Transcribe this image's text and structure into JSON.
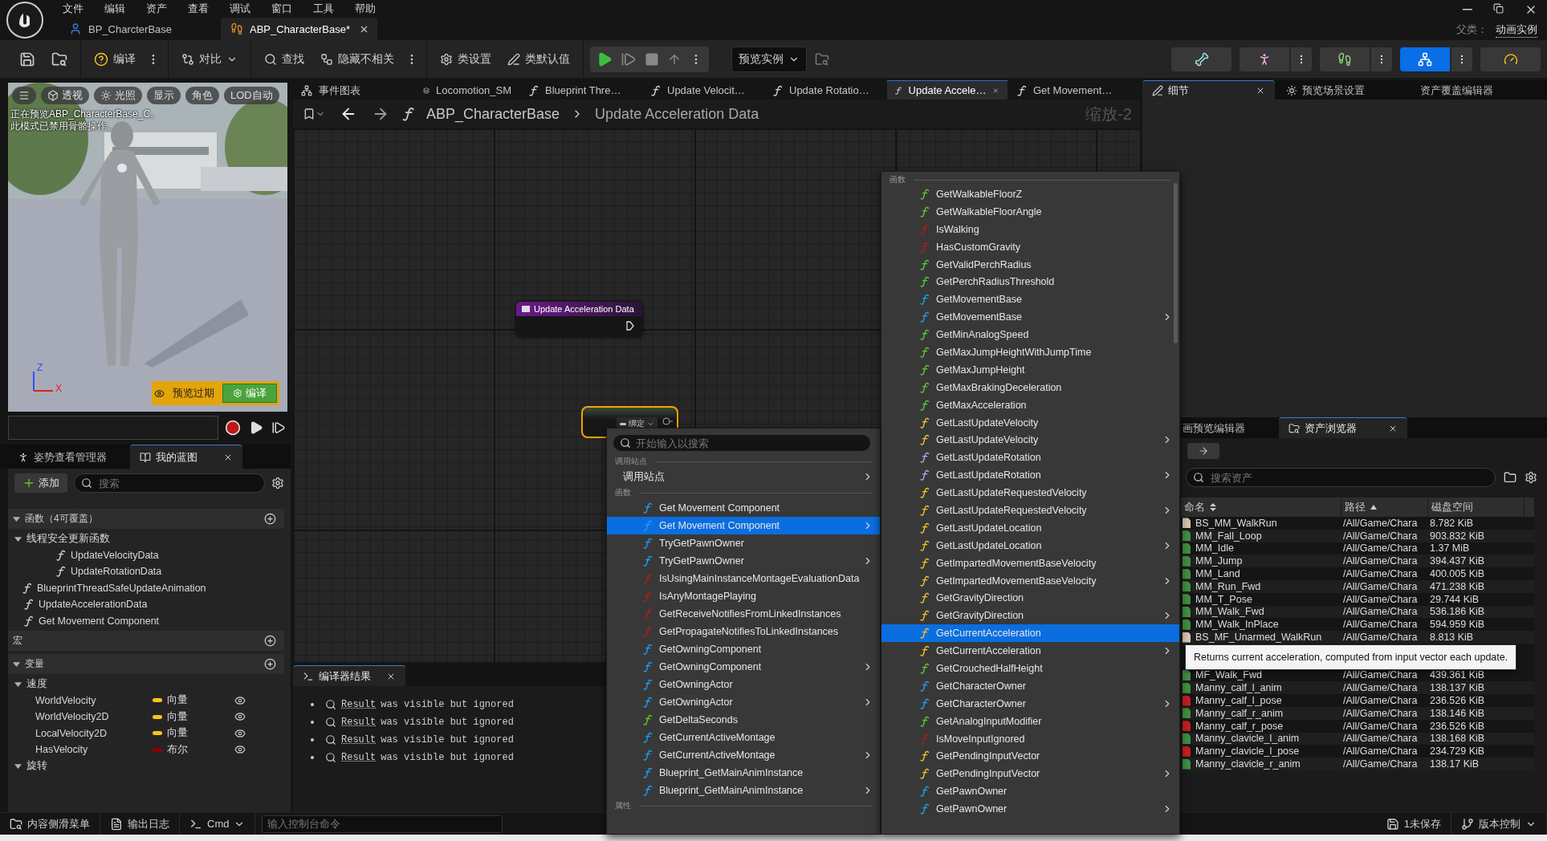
{
  "title_bar": {
    "menu": [
      "文件",
      "编辑",
      "资产",
      "查看",
      "调试",
      "窗口",
      "工具",
      "帮助"
    ],
    "documents": [
      {
        "label": "BP_CharcterBase",
        "kind": "blueprint",
        "selected": false,
        "closable": false
      },
      {
        "label": "ABP_CharacterBase*",
        "kind": "anim",
        "selected": true,
        "closable": true
      }
    ],
    "parent_class": {
      "label": "父类：",
      "value": "动画实例"
    }
  },
  "toolbar": {
    "groups": [
      [
        {
          "kind": "save"
        },
        {
          "kind": "browse"
        }
      ],
      [
        {
          "kind": "compile",
          "label": "编译",
          "kebab": true
        }
      ],
      [
        {
          "kind": "diff",
          "label": "对比",
          "menu": true
        }
      ],
      [
        {
          "kind": "find",
          "label": "查找"
        },
        {
          "kind": "hide",
          "label": "隐藏不相关",
          "kebab": true
        }
      ],
      [
        {
          "kind": "class_settings",
          "label": "类设置"
        },
        {
          "kind": "class_defaults",
          "label": "类默认值"
        }
      ]
    ],
    "preview_instance": {
      "label": "预览实例",
      "menu": true
    },
    "modes": [
      {
        "kind": "skeleton",
        "selected": false,
        "kebab": false
      },
      {
        "kind": "mesh",
        "selected": false,
        "kebab": true
      },
      {
        "kind": "animation",
        "selected": false,
        "kebab": true
      },
      {
        "kind": "blueprint",
        "selected": true,
        "kebab": true
      },
      {
        "kind": "physics",
        "selected": false,
        "kebab": false
      }
    ]
  },
  "viewport": {
    "buttons": [
      {
        "kind": "menu"
      },
      {
        "kind": "perspective",
        "label": "透视"
      },
      {
        "kind": "lighting",
        "label": "光照"
      },
      {
        "label": "显示"
      },
      {
        "label": "角色"
      },
      {
        "label": "LOD自动"
      }
    ],
    "notice": [
      "正在预览ABP_CharacterBase_C。",
      "此模式已禁用骨骼操作。"
    ],
    "axes": [
      "Z",
      "X"
    ],
    "stale": "预览过期",
    "compile_button": "编译"
  },
  "my_blueprint": {
    "tabs": [
      {
        "label": "姿势查看管理器",
        "kind": "pose",
        "selected": false
      },
      {
        "label": "我的蓝图",
        "kind": "book",
        "selected": true
      }
    ],
    "add_button": "添加",
    "search": {
      "placeholder": "搜索"
    },
    "sections": [
      {
        "title": "函数（4可覆盖）",
        "expanded": true,
        "items": [
          {
            "kind": "category",
            "label": "线程安全更新函数",
            "expanded": true,
            "children": [
              {
                "kind": "function",
                "label": "UpdateVelocityData"
              },
              {
                "kind": "function",
                "label": "UpdateRotationData"
              }
            ]
          },
          {
            "kind": "override",
            "label": "BlueprintThreadSafeUpdateAnimation"
          },
          {
            "kind": "function",
            "label": "UpdateAccelerationData"
          },
          {
            "kind": "function",
            "label": "Get Movement Component"
          }
        ]
      },
      {
        "title": "宏"
      },
      {
        "title": "变量",
        "expanded": true,
        "items": [
          {
            "kind": "category",
            "label": "速度",
            "expanded": true,
            "children": [
              {
                "kind": "variable",
                "label": "WorldVelocity",
                "type": "向量",
                "color": "#f5c518"
              },
              {
                "kind": "variable",
                "label": "WorldVelocity2D",
                "type": "向量",
                "color": "#f5c518"
              },
              {
                "kind": "variable",
                "label": "LocalVelocity2D",
                "type": "向量",
                "color": "#f5c518"
              },
              {
                "kind": "variable",
                "label": "HasVelocity",
                "type": "布尔",
                "color": "#8c0000"
              }
            ]
          },
          {
            "kind": "category",
            "label": "旋转",
            "expanded": true
          }
        ]
      }
    ]
  },
  "graph": {
    "tabs": [
      {
        "label": "事件图表",
        "kind": "graph",
        "selected": false,
        "closable": false
      },
      {
        "label": "Locomotion_SM",
        "kind": "state_machine",
        "selected": false,
        "closable": false
      },
      {
        "label": "Blueprint Thre…",
        "kind": "function",
        "selected": false,
        "closable": false
      },
      {
        "label": "Update Velocit…",
        "kind": "function",
        "selected": false,
        "closable": false
      },
      {
        "label": "Update Rotatio…",
        "kind": "function",
        "selected": false,
        "closable": false
      },
      {
        "label": "Update Accele…",
        "kind": "function",
        "selected": true,
        "closable": true
      },
      {
        "label": "Get Movement…",
        "kind": "function",
        "selected": false,
        "closable": false
      }
    ],
    "breadcrumb": [
      "ABP_CharacterBase",
      "Update Acceleration Data"
    ],
    "zoom": "缩放-2",
    "entry_node": {
      "title": "Update Acceleration Data"
    },
    "pending_node": {
      "binding": "绑定",
      "selected": true
    },
    "compiler_results": {
      "title": "编译器结果",
      "messages": [
        {
          "link": "Result",
          "text": "was visible but ignored"
        },
        {
          "link": "Result",
          "text": "was visible but ignored"
        },
        {
          "link": "Result",
          "text": "was visible but ignored"
        },
        {
          "link": "Result",
          "text": "was visible but ignored"
        }
      ]
    }
  },
  "details": {
    "tabs": [
      {
        "label": "细节",
        "kind": "details",
        "selected": true,
        "closable": true
      },
      {
        "label": "预览场景设置",
        "kind": "scene",
        "selected": false,
        "closable": false
      },
      {
        "label": "资产覆盖编辑器",
        "selected": false,
        "closable": false
      }
    ]
  },
  "asset_browser": {
    "tabs": [
      {
        "label": "画预览编辑器",
        "selected": false,
        "closable": false
      },
      {
        "label": "资产浏览器",
        "kind": "browser",
        "selected": true,
        "closable": true
      }
    ],
    "search": {
      "placeholder": "搜索资产"
    },
    "columns": [
      {
        "label": "命名",
        "sortable": true,
        "sorted": false
      },
      {
        "label": "路径",
        "sortable": true,
        "sorted": true
      },
      {
        "label": "磁盘空间",
        "sortable": false,
        "sorted": false
      }
    ],
    "rows": [
      {
        "name": "BS_MM_WalkRun",
        "path": "/All/Game/Chara",
        "size": "8.782 KiB",
        "color": "#d9c3b0"
      },
      {
        "name": "MM_Fall_Loop",
        "path": "/All/Game/Chara",
        "size": "903.832 KiB",
        "color": "#3f8f3f"
      },
      {
        "name": "MM_Idle",
        "path": "/All/Game/Chara",
        "size": "1.37 MiB",
        "color": "#3f8f3f"
      },
      {
        "name": "MM_Jump",
        "path": "/All/Game/Chara",
        "size": "394.437 KiB",
        "color": "#3f8f3f"
      },
      {
        "name": "MM_Land",
        "path": "/All/Game/Chara",
        "size": "400.005 KiB",
        "color": "#3f8f3f"
      },
      {
        "name": "MM_Run_Fwd",
        "path": "/All/Game/Chara",
        "size": "471.238 KiB",
        "color": "#3f8f3f"
      },
      {
        "name": "MM_T_Pose",
        "path": "/All/Game/Chara",
        "size": "29.744 KiB",
        "color": "#3f8f3f"
      },
      {
        "name": "MM_Walk_Fwd",
        "path": "/All/Game/Chara",
        "size": "536.186 KiB",
        "color": "#3f8f3f"
      },
      {
        "name": "MM_Walk_InPlace",
        "path": "/All/Game/Chara",
        "size": "594.959 KiB",
        "color": "#3f8f3f"
      },
      {
        "name": "BS_MF_Unarmed_WalkRun",
        "path": "/All/Game/Chara",
        "size": "8.813 KiB",
        "color": "#d9c3b0"
      }
    ],
    "rows_after_tooltip": [
      {
        "name": "MF_Walk_Fwd",
        "path": "/All/Game/Chara",
        "size": "439.361 KiB",
        "color": "#3f8f3f"
      },
      {
        "name": "Manny_calf_l_anim",
        "path": "/All/Game/Chara",
        "size": "138.137 KiB",
        "color": "#3f8f3f"
      },
      {
        "name": "Manny_calf_l_pose",
        "path": "/All/Game/Chara",
        "size": "236.526 KiB",
        "color": "#c81e1e"
      },
      {
        "name": "Manny_calf_r_anim",
        "path": "/All/Game/Chara",
        "size": "138.146 KiB",
        "color": "#3f8f3f"
      },
      {
        "name": "Manny_calf_r_pose",
        "path": "/All/Game/Chara",
        "size": "236.526 KiB",
        "color": "#c81e1e"
      },
      {
        "name": "Manny_clavicle_l_anim",
        "path": "/All/Game/Chara",
        "size": "138.168 KiB",
        "color": "#3f8f3f"
      },
      {
        "name": "Manny_clavicle_l_pose",
        "path": "/All/Game/Chara",
        "size": "234.729 KiB",
        "color": "#c81e1e"
      },
      {
        "name": "Manny_clavicle_r_anim",
        "path": "/All/Game/Chara",
        "size": "138.17 KiB",
        "color": "#3f8f3f"
      }
    ]
  },
  "action_menu": {
    "search": {
      "placeholder": "开始输入以搜索"
    },
    "sections": [
      {
        "title": "调用站点",
        "items": [
          {
            "kind": "category",
            "label": "调用站点",
            "submenu": true,
            "selected": false
          }
        ]
      },
      {
        "title": "函数",
        "items": [
          {
            "kind": "function",
            "label": "Get Movement Component",
            "color": "#1e9bf0",
            "submenu": false,
            "selected": false
          },
          {
            "kind": "function",
            "label": "Get Movement Component",
            "color": "#1e9bf0",
            "submenu": true,
            "selected": true
          },
          {
            "kind": "function",
            "label": "TryGetPawnOwner",
            "color": "#1e9bf0",
            "submenu": false,
            "selected": false
          },
          {
            "kind": "function",
            "label": "TryGetPawnOwner",
            "color": "#1e9bf0",
            "submenu": true,
            "selected": false
          },
          {
            "kind": "function",
            "label": "IsUsingMainInstanceMontageEvaluationData",
            "color": "#b01c1c",
            "submenu": false,
            "selected": false
          },
          {
            "kind": "function",
            "label": "IsAnyMontagePlaying",
            "color": "#b01c1c",
            "submenu": false,
            "selected": false
          },
          {
            "kind": "function",
            "label": "GetReceiveNotifiesFromLinkedInstances",
            "color": "#b01c1c",
            "submenu": false,
            "selected": false
          },
          {
            "kind": "function",
            "label": "GetPropagateNotifiesToLinkedInstances",
            "color": "#b01c1c",
            "submenu": false,
            "selected": false
          },
          {
            "kind": "function",
            "label": "GetOwningComponent",
            "color": "#1e9bf0",
            "submenu": false,
            "selected": false
          },
          {
            "kind": "function",
            "label": "GetOwningComponent",
            "color": "#1e9bf0",
            "submenu": true,
            "selected": false
          },
          {
            "kind": "function",
            "label": "GetOwningActor",
            "color": "#1e9bf0",
            "submenu": false,
            "selected": false
          },
          {
            "kind": "function",
            "label": "GetOwningActor",
            "color": "#1e9bf0",
            "submenu": true,
            "selected": false
          },
          {
            "kind": "function",
            "label": "GetDeltaSeconds",
            "color": "#5ac82a",
            "submenu": false,
            "selected": false
          },
          {
            "kind": "function",
            "label": "GetCurrentActiveMontage",
            "color": "#1e9bf0",
            "submenu": false,
            "selected": false
          },
          {
            "kind": "function",
            "label": "GetCurrentActiveMontage",
            "color": "#1e9bf0",
            "submenu": true,
            "selected": false
          },
          {
            "kind": "function",
            "label": "Blueprint_GetMainAnimInstance",
            "color": "#1e9bf0",
            "submenu": false,
            "selected": false
          },
          {
            "kind": "function",
            "label": "Blueprint_GetMainAnimInstance",
            "color": "#1e9bf0",
            "submenu": true,
            "selected": false
          }
        ]
      },
      {
        "title": "属性"
      }
    ]
  },
  "submenu": {
    "sections": [
      {
        "title": "函数",
        "items": [
          {
            "label": "GetWalkableFloorZ",
            "color": "#5ac82a",
            "submenu": false,
            "selected": false
          },
          {
            "label": "GetWalkableFloorAngle",
            "color": "#5ac82a",
            "submenu": false,
            "selected": false
          },
          {
            "label": "IsWalking",
            "color": "#b01c1c",
            "submenu": false,
            "selected": false
          },
          {
            "label": "HasCustomGravity",
            "color": "#b01c1c",
            "submenu": false,
            "selected": false
          },
          {
            "label": "GetValidPerchRadius",
            "color": "#5ac82a",
            "submenu": false,
            "selected": false
          },
          {
            "label": "GetPerchRadiusThreshold",
            "color": "#5ac82a",
            "submenu": false,
            "selected": false
          },
          {
            "label": "GetMovementBase",
            "color": "#1e9bf0",
            "submenu": false,
            "selected": false
          },
          {
            "label": "GetMovementBase",
            "color": "#1e9bf0",
            "submenu": true,
            "selected": false
          },
          {
            "label": "GetMinAnalogSpeed",
            "color": "#5ac82a",
            "submenu": false,
            "selected": false
          },
          {
            "label": "GetMaxJumpHeightWithJumpTime",
            "color": "#5ac82a",
            "submenu": false,
            "selected": false
          },
          {
            "label": "GetMaxJumpHeight",
            "color": "#5ac82a",
            "submenu": false,
            "selected": false
          },
          {
            "label": "GetMaxBrakingDeceleration",
            "color": "#5ac82a",
            "submenu": false,
            "selected": false
          },
          {
            "label": "GetMaxAcceleration",
            "color": "#5ac82a",
            "submenu": false,
            "selected": false
          },
          {
            "label": "GetLastUpdateVelocity",
            "color": "#f0c020",
            "submenu": false,
            "selected": false
          },
          {
            "label": "GetLastUpdateVelocity",
            "color": "#f0c020",
            "submenu": true,
            "selected": false
          },
          {
            "label": "GetLastUpdateRotation",
            "color": "#a0a8f0",
            "submenu": false,
            "selected": false
          },
          {
            "label": "GetLastUpdateRotation",
            "color": "#a0a8f0",
            "submenu": true,
            "selected": false
          },
          {
            "label": "GetLastUpdateRequestedVelocity",
            "color": "#f0c020",
            "submenu": false,
            "selected": false
          },
          {
            "label": "GetLastUpdateRequestedVelocity",
            "color": "#f0c020",
            "submenu": true,
            "selected": false
          },
          {
            "label": "GetLastUpdateLocation",
            "color": "#f0c020",
            "submenu": false,
            "selected": false
          },
          {
            "label": "GetLastUpdateLocation",
            "color": "#f0c020",
            "submenu": true,
            "selected": false
          },
          {
            "label": "GetImpartedMovementBaseVelocity",
            "color": "#f0c020",
            "submenu": false,
            "selected": false
          },
          {
            "label": "GetImpartedMovementBaseVelocity",
            "color": "#f0c020",
            "submenu": true,
            "selected": false
          },
          {
            "label": "GetGravityDirection",
            "color": "#f0c020",
            "submenu": false,
            "selected": false
          },
          {
            "label": "GetGravityDirection",
            "color": "#f0c020",
            "submenu": true,
            "selected": false
          },
          {
            "label": "GetCurrentAcceleration",
            "color": "#f0c020",
            "submenu": false,
            "selected": true
          },
          {
            "label": "GetCurrentAcceleration",
            "color": "#f0c020",
            "submenu": true,
            "selected": false
          },
          {
            "label": "GetCrouchedHalfHeight",
            "color": "#5ac82a",
            "submenu": false,
            "selected": false
          },
          {
            "label": "GetCharacterOwner",
            "color": "#1e9bf0",
            "submenu": false,
            "selected": false
          },
          {
            "label": "GetCharacterOwner",
            "color": "#1e9bf0",
            "submenu": true,
            "selected": false
          },
          {
            "label": "GetAnalogInputModifier",
            "color": "#5ac82a",
            "submenu": false,
            "selected": false
          },
          {
            "label": "IsMoveInputIgnored",
            "color": "#b01c1c",
            "submenu": false,
            "selected": false
          },
          {
            "label": "GetPendingInputVector",
            "color": "#f0c020",
            "submenu": false,
            "selected": false
          },
          {
            "label": "GetPendingInputVector",
            "color": "#f0c020",
            "submenu": true,
            "selected": false
          },
          {
            "label": "GetPawnOwner",
            "color": "#1e9bf0",
            "submenu": false,
            "selected": false
          },
          {
            "label": "GetPawnOwner",
            "color": "#1e9bf0",
            "submenu": true,
            "selected": false
          }
        ]
      }
    ]
  },
  "tooltip": "Returns current acceleration, computed from input vector each update.",
  "status_bar": {
    "left": [
      {
        "kind": "drawer",
        "label": "内容侧滑菜单"
      },
      {
        "kind": "log",
        "label": "输出日志"
      },
      {
        "kind": "cmd",
        "label": "Cmd",
        "menu": true
      }
    ],
    "console": {
      "placeholder": "输入控制台命令"
    },
    "right": [
      {
        "kind": "unsaved",
        "label": "1未保存"
      },
      {
        "kind": "source_control",
        "label": "版本控制",
        "menu": true
      }
    ]
  }
}
